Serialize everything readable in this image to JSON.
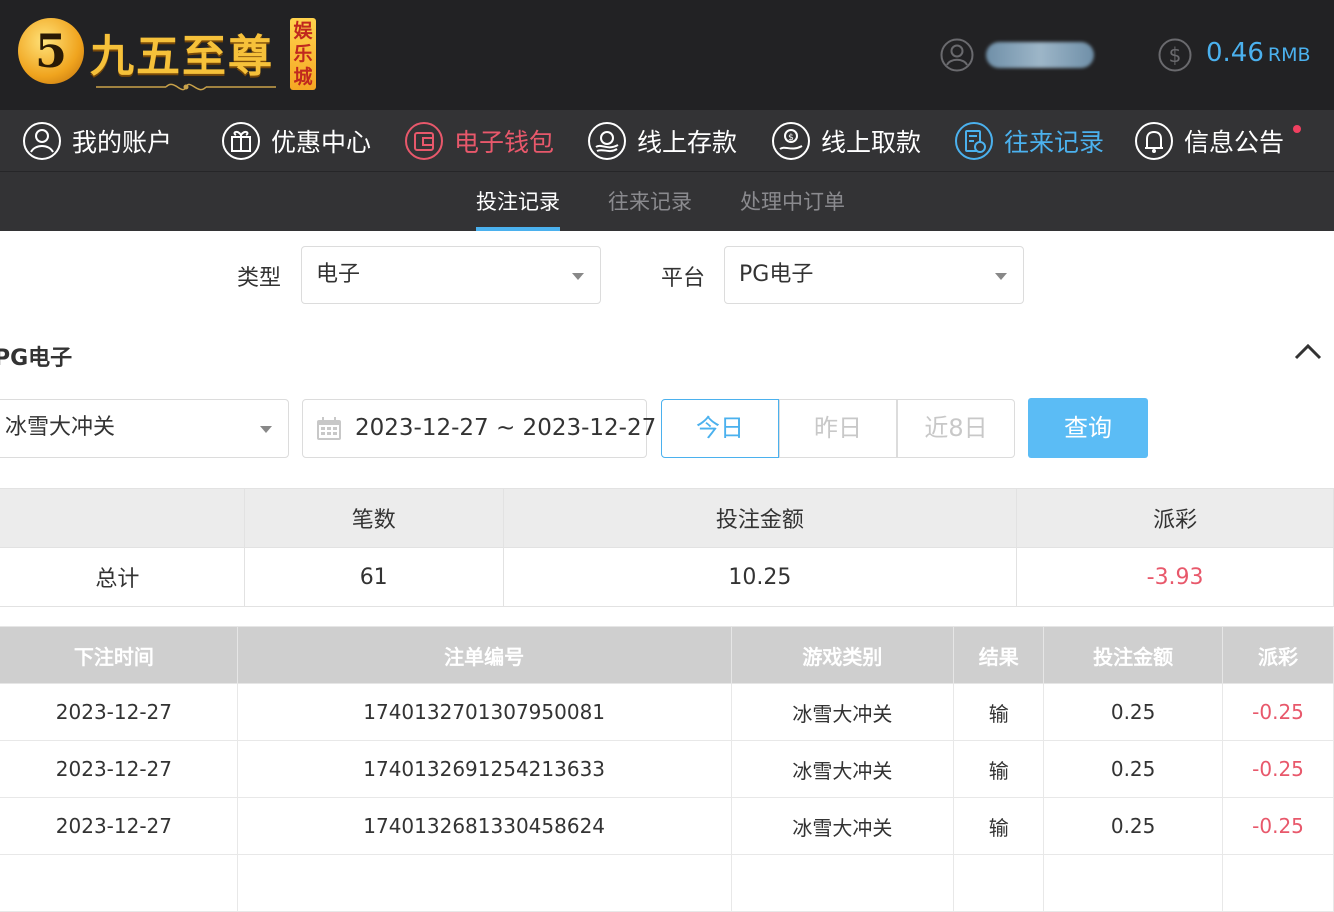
{
  "brand": {
    "logo_digit": "5",
    "logo_text": "九五至尊",
    "logo_badge": "娱乐城"
  },
  "account": {
    "balance": "0.46",
    "currency": "RMB"
  },
  "nav": [
    {
      "label": "我的账户",
      "icon": "user-circle-icon"
    },
    {
      "label": "优惠中心",
      "icon": "gift-icon"
    },
    {
      "label": "电子钱包",
      "icon": "wallet-icon"
    },
    {
      "label": "线上存款",
      "icon": "deposit-icon"
    },
    {
      "label": "线上取款",
      "icon": "withdraw-icon"
    },
    {
      "label": "往来记录",
      "icon": "records-icon"
    },
    {
      "label": "信息公告",
      "icon": "bell-icon"
    }
  ],
  "subtabs": [
    "投注记录",
    "往来记录",
    "处理中订单"
  ],
  "filters": {
    "type_label": "类型",
    "type_value": "电子",
    "platform_label": "平台",
    "platform_value": "PG电子"
  },
  "section_title": "PG电子",
  "query": {
    "game": "冰雪大冲关",
    "date_range": "2023-12-27 ~ 2023-12-27",
    "quick": [
      "今日",
      "昨日",
      "近8日"
    ],
    "button": "查询"
  },
  "summary": {
    "headers": [
      "",
      "笔数",
      "投注金额",
      "派彩"
    ],
    "row": {
      "label": "总计",
      "count": "61",
      "amount": "10.25",
      "payout": "-3.93"
    }
  },
  "records": {
    "headers": [
      "下注时间",
      "注单编号",
      "游戏类别",
      "结果",
      "投注金额",
      "派彩"
    ],
    "rows": [
      {
        "time": "2023-12-27",
        "id": "1740132701307950081",
        "game": "冰雪大冲关",
        "result": "输",
        "amount": "0.25",
        "payout": "-0.25"
      },
      {
        "time": "2023-12-27",
        "id": "1740132691254213633",
        "game": "冰雪大冲关",
        "result": "输",
        "amount": "0.25",
        "payout": "-0.25"
      },
      {
        "time": "2023-12-27",
        "id": "1740132681330458624",
        "game": "冰雪大冲关",
        "result": "输",
        "amount": "0.25",
        "payout": "-0.25"
      }
    ]
  },
  "colors": {
    "accent": "#4bb1ee",
    "pink": "#e8586b",
    "header_bg": "#222224",
    "nav_bg": "#333335"
  }
}
